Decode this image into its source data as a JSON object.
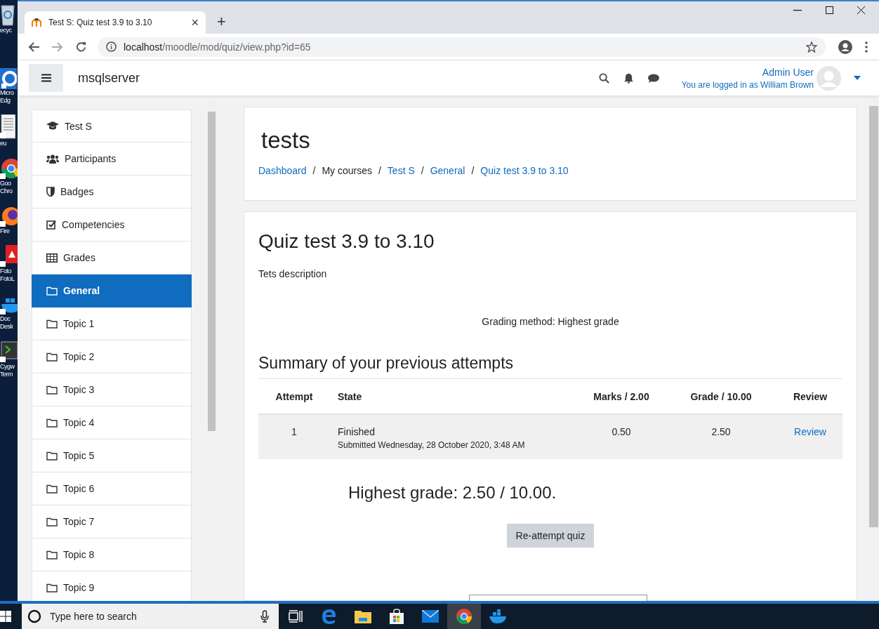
{
  "desktop": {
    "icons": [
      {
        "kind": "recycle",
        "lines": [
          "ecyc"
        ]
      },
      {
        "kind": "edge",
        "lines": [
          "Micro",
          "Edg"
        ]
      },
      {
        "kind": "document",
        "lines": [
          "eu"
        ]
      },
      {
        "kind": "chrome",
        "lines": [
          "Goo",
          "Chro"
        ]
      },
      {
        "kind": "firefox",
        "lines": [
          "Fire"
        ]
      },
      {
        "kind": "foto",
        "lines": [
          "Foto",
          "FotoL"
        ]
      },
      {
        "kind": "docker",
        "lines": [
          "Doc",
          "Desk"
        ]
      },
      {
        "kind": "terminal",
        "lines": [
          "Cygw",
          "Term"
        ]
      }
    ]
  },
  "browser": {
    "tab": {
      "title": "Test S: Quiz test 3.9 to 3.10",
      "close": "×"
    },
    "new_tab": "+",
    "url": {
      "host": "localhost",
      "path": "/moodle/mod/quiz/view.php?id=65"
    }
  },
  "navbar": {
    "site_name": "msqlserver",
    "user_name": "Admin User",
    "login_note": "You are logged in as William Brown"
  },
  "sidebar": {
    "items": [
      {
        "label": "Test S",
        "kind": "course",
        "selected": false
      },
      {
        "label": "Participants",
        "kind": "participants",
        "selected": false
      },
      {
        "label": "Badges",
        "kind": "badges",
        "selected": false
      },
      {
        "label": "Competencies",
        "kind": "competencies",
        "selected": false
      },
      {
        "label": "Grades",
        "kind": "grades",
        "selected": false
      },
      {
        "label": "General",
        "kind": "section",
        "selected": true
      },
      {
        "label": "Topic 1",
        "kind": "section",
        "selected": false
      },
      {
        "label": "Topic 2",
        "kind": "section",
        "selected": false
      },
      {
        "label": "Topic 3",
        "kind": "section",
        "selected": false
      },
      {
        "label": "Topic 4",
        "kind": "section",
        "selected": false
      },
      {
        "label": "Topic 5",
        "kind": "section",
        "selected": false
      },
      {
        "label": "Topic 6",
        "kind": "section",
        "selected": false
      },
      {
        "label": "Topic 7",
        "kind": "section",
        "selected": false
      },
      {
        "label": "Topic 8",
        "kind": "section",
        "selected": false
      },
      {
        "label": "Topic 9",
        "kind": "section",
        "selected": false
      }
    ]
  },
  "header": {
    "title": "tests",
    "separator": "/",
    "breadcrumb": [
      {
        "label": "Dashboard",
        "kind": "link"
      },
      {
        "label": "My courses",
        "kind": "text"
      },
      {
        "label": "Test S",
        "kind": "link"
      },
      {
        "label": "General",
        "kind": "link"
      },
      {
        "label": "Quiz test 3.9 to 3.10",
        "kind": "link"
      }
    ]
  },
  "quiz": {
    "title": "Quiz test 3.9 to 3.10",
    "description": "Tets description",
    "grading_method": "Grading method: Highest grade",
    "summary_heading": "Summary of your previous attempts",
    "table": {
      "columns": [
        "Attempt",
        "State",
        "Marks / 2.00",
        "Grade / 10.00",
        "Review"
      ],
      "rows": [
        {
          "attempt": "1",
          "state": "Finished",
          "submitted": "Submitted Wednesday, 28 October 2020, 3:48 AM",
          "marks": "0.50",
          "grade": "2.50",
          "review": "Review",
          "highlighted": true
        }
      ]
    },
    "result": "Highest grade: 2.50 / 10.00.",
    "button": "Re-attempt quiz"
  },
  "taskbar": {
    "search_placeholder": "Type here to search",
    "apps": [
      {
        "kind": "taskview",
        "selected": false
      },
      {
        "kind": "edge",
        "selected": false
      },
      {
        "kind": "explorer",
        "selected": false
      },
      {
        "kind": "store",
        "selected": false
      },
      {
        "kind": "mail",
        "selected": false
      },
      {
        "kind": "chrome",
        "selected": true
      },
      {
        "kind": "docker",
        "selected": false
      }
    ]
  }
}
